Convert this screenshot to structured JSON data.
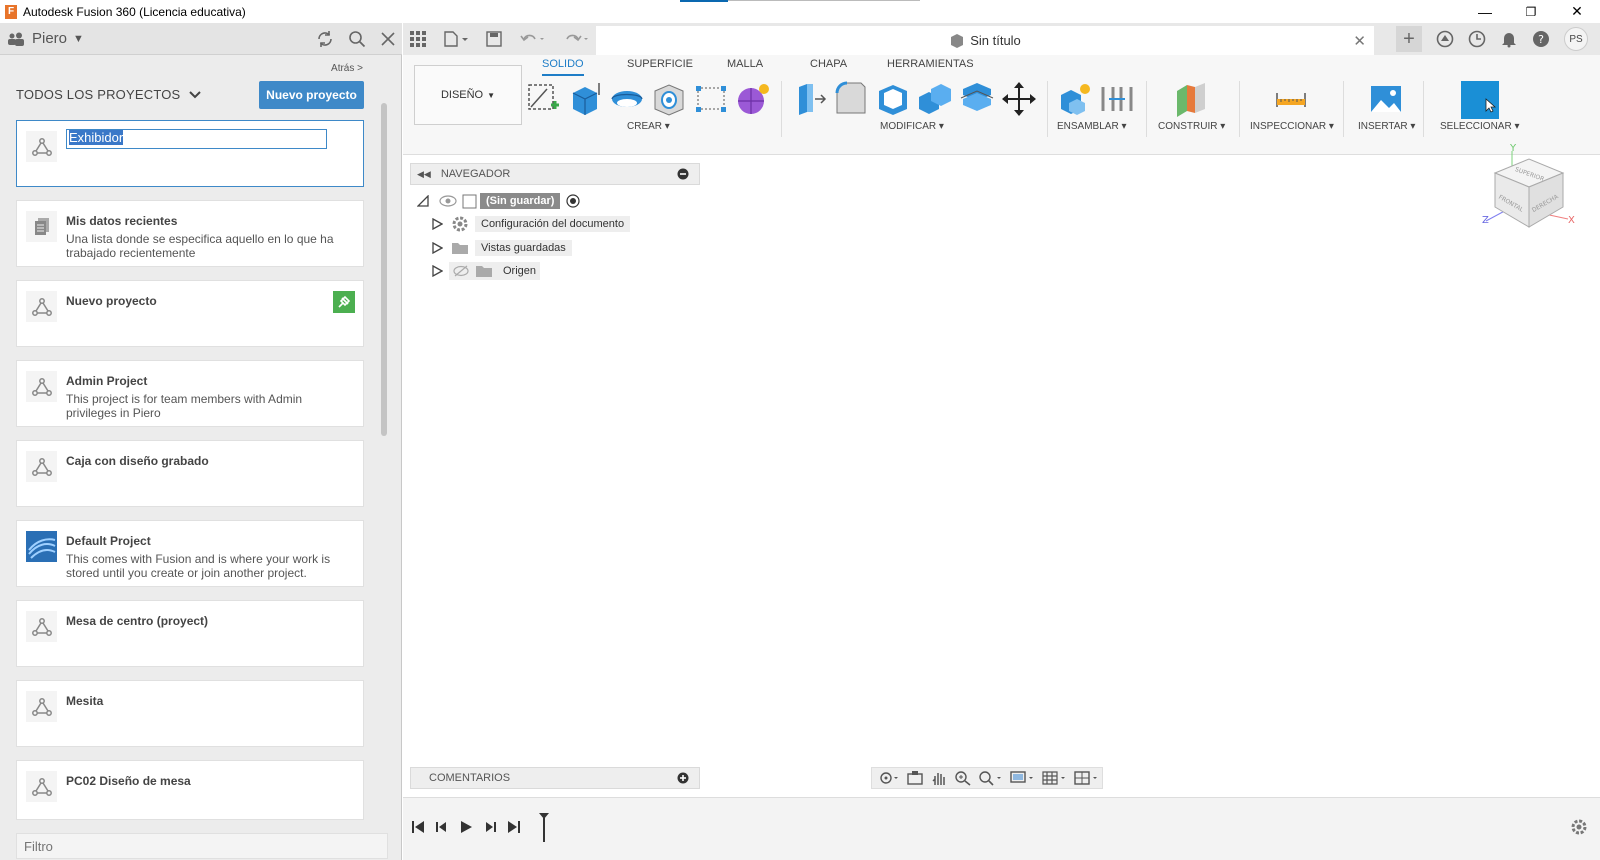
{
  "window": {
    "title": "Autodesk Fusion 360 (Licencia educativa)",
    "app_icon_letter": "F",
    "minimize": "—",
    "maximize": "❐",
    "close": "✕"
  },
  "left_panel": {
    "user": "Piero",
    "back_link": "Atrás >",
    "all_projects": "TODOS LOS PROYECTOS",
    "new_project_button": "Nuevo proyecto",
    "editing_value": "Exhibidor",
    "projects": [
      {
        "name": "Mis datos recientes",
        "desc": "Una lista donde se especifica aquello en lo que ha trabajado recientemente"
      },
      {
        "name": "Nuevo proyecto",
        "desc": ""
      },
      {
        "name": "Admin Project",
        "desc": "This project is for team members with Admin privileges in Piero"
      },
      {
        "name": "Caja con diseño grabado",
        "desc": ""
      },
      {
        "name": "Default Project",
        "desc": "This comes with Fusion and is where your work is stored until you create or join another project."
      },
      {
        "name": "Mesa de centro (proyect)",
        "desc": ""
      },
      {
        "name": "Mesita",
        "desc": ""
      },
      {
        "name": "PC02 Diseño de mesa",
        "desc": ""
      }
    ],
    "filter_placeholder": "Filtro"
  },
  "document": {
    "tab_title": "Sin título"
  },
  "ribbon": {
    "workspace": "DISEÑO",
    "tabs": [
      "SOLIDO",
      "SUPERFICIE",
      "MALLA",
      "CHAPA",
      "HERRAMIENTAS"
    ],
    "active_tab": "SOLIDO",
    "groups": {
      "crear": "CREAR",
      "modificar": "MODIFICAR",
      "ensamblar": "ENSAMBLAR",
      "construir": "CONSTRUIR",
      "inspeccionar": "INSPECCIONAR",
      "insertar": "INSERTAR",
      "seleccionar": "SELECCIONAR"
    }
  },
  "browser": {
    "title": "NAVEGADOR",
    "root": "(Sin guardar)",
    "items": [
      "Configuración del documento",
      "Vistas guardadas",
      "Origen"
    ]
  },
  "viewcube": {
    "top": "SUPERIOR",
    "front": "FRONTAL",
    "right": "DERECHA",
    "axis_x": "X",
    "axis_y": "Y",
    "axis_z": "Z"
  },
  "comments": {
    "title": "COMENTARIOS"
  },
  "user_initials": "PS",
  "colors": {
    "accent": "#1e7dc7",
    "button_blue": "#3e89c8",
    "select_blue": "#1a8fd6",
    "green_badge": "#4caf50"
  }
}
